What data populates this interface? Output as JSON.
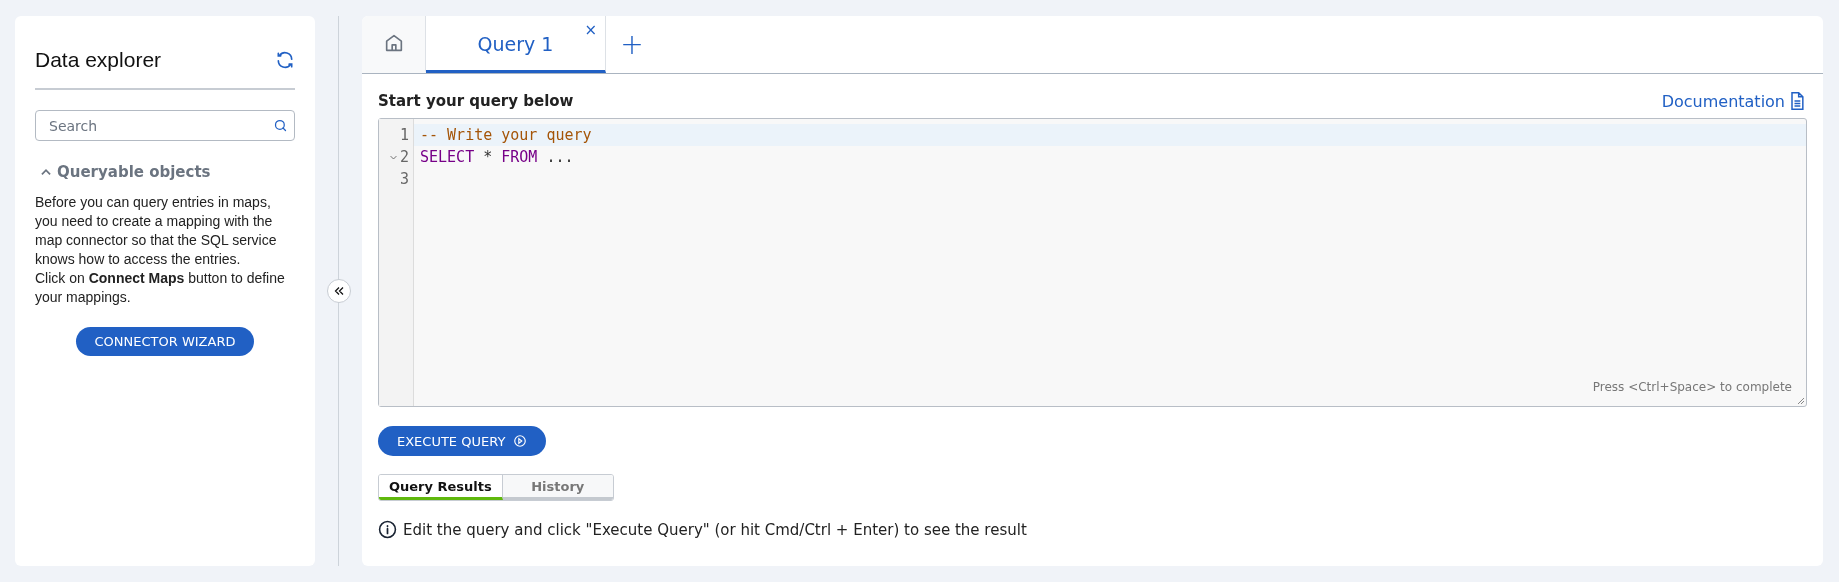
{
  "sidebar": {
    "title": "Data explorer",
    "search": {
      "placeholder": "Search"
    },
    "section": {
      "title": "Queryable objects",
      "expanded": true,
      "paragraphs": [
        "Before you can query entries in maps, you need to create a mapping with the map connector so that the SQL service knows how to access the entries.",
        "Click on **Connect Maps** button to define your mappings."
      ],
      "button": "CONNECTOR WIZARD"
    }
  },
  "tabs": [
    {
      "kind": "home",
      "selected": false
    },
    {
      "kind": "query",
      "label": "Query 1",
      "selected": true,
      "close": "×"
    }
  ],
  "add_tab": "+",
  "editor": {
    "title": "Start your query below",
    "documentation": "Documentation",
    "lines": [
      {
        "number": "1",
        "active": true,
        "foldable": false,
        "tokens": [
          {
            "kind": "comment",
            "text": "-- Write your query"
          }
        ]
      },
      {
        "number": "2",
        "active": false,
        "foldable": true,
        "tokens": [
          {
            "kind": "keyword",
            "text": "SELECT"
          },
          {
            "kind": "plain",
            "text": " * "
          },
          {
            "kind": "keyword",
            "text": "FROM"
          },
          {
            "kind": "plain",
            "text": " ..."
          }
        ]
      },
      {
        "number": "3",
        "active": false,
        "foldable": false
      }
    ],
    "hint": "Press <Ctrl+Space> to complete"
  },
  "execute_button": "EXECUTE QUERY",
  "result_tabs": [
    {
      "label": "Query Results",
      "selected": true
    },
    {
      "label": "History",
      "selected": false
    }
  ],
  "info": "Edit the query and click \"Execute Query\" (or hit Cmd/Ctrl + Enter) to see the result"
}
